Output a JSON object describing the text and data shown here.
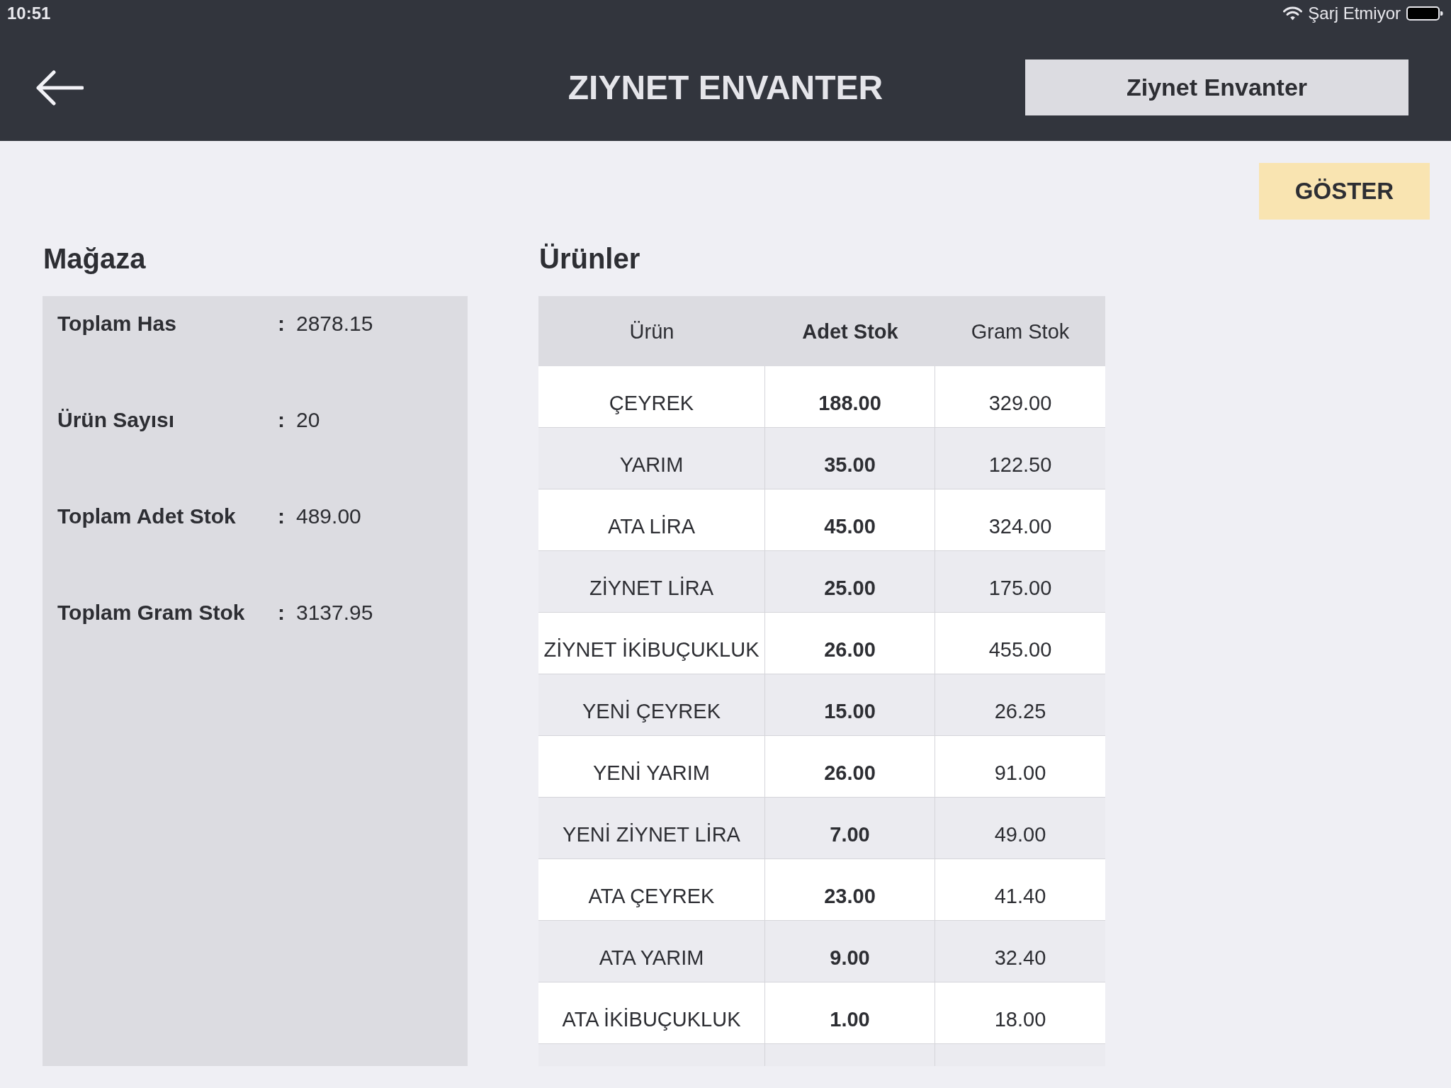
{
  "status_bar": {
    "time": "10:51",
    "charging_status": "Şarj Etmiyor"
  },
  "nav_bar": {
    "title": "ZIYNET ENVANTER",
    "action_button": "Ziynet Envanter"
  },
  "show_button": "GÖSTER",
  "store": {
    "title": "Mağaza",
    "stats": [
      {
        "label": "Toplam Has",
        "separator": ":",
        "value": "2878.15"
      },
      {
        "label": "Ürün Sayısı",
        "separator": ":",
        "value": "20"
      },
      {
        "label": "Toplam Adet Stok",
        "separator": ":",
        "value": "489.00"
      },
      {
        "label": "Toplam Gram Stok",
        "separator": ":",
        "value": "3137.95"
      }
    ]
  },
  "products": {
    "title": "Ürünler",
    "table": {
      "columns": [
        {
          "label": "Ürün",
          "selected": false
        },
        {
          "label": "Adet Stok",
          "selected": true
        },
        {
          "label": "Gram Stok",
          "selected": false
        }
      ],
      "rows": [
        [
          "ÇEYREK",
          "188.00",
          "329.00"
        ],
        [
          "YARIM",
          "35.00",
          "122.50"
        ],
        [
          "ATA LİRA",
          "45.00",
          "324.00"
        ],
        [
          "ZİYNET LİRA",
          "25.00",
          "175.00"
        ],
        [
          "ZİYNET İKİBUÇUKLUK",
          "26.00",
          "455.00"
        ],
        [
          "YENİ ÇEYREK",
          "15.00",
          "26.25"
        ],
        [
          "YENİ YARIM",
          "26.00",
          "91.00"
        ],
        [
          "YENİ ZİYNET LİRA",
          "7.00",
          "49.00"
        ],
        [
          "ATA ÇEYREK",
          "23.00",
          "41.40"
        ],
        [
          "ATA YARIM",
          "9.00",
          "32.40"
        ],
        [
          "ATA İKİBUÇUKLUK",
          "1.00",
          "18.00"
        ]
      ]
    }
  }
}
